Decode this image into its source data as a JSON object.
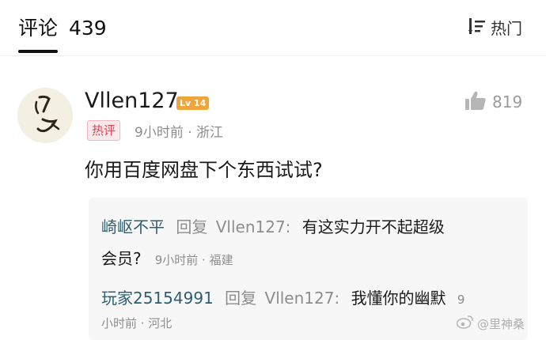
{
  "header": {
    "comments_label": "评论",
    "comments_count": "439",
    "sort_label": "热门"
  },
  "comment": {
    "username": "Vllen127",
    "level": "Lv 14",
    "likes": "819",
    "hot_badge": "热评",
    "meta": "9小时前 · 浙江",
    "text": "你用百度网盘下个东西试试?"
  },
  "replies": [
    {
      "user": "崎岖不平",
      "action": "回复",
      "target": "Vllen127:",
      "text_line1": "有这实力开不起超级",
      "text_line2": "会员?",
      "meta": "9小时前 · 福建"
    },
    {
      "user": "玩家25154991",
      "action": "回复",
      "target": "Vllen127:",
      "text": "我懂你的幽默",
      "meta_line1": "9",
      "meta_line2": "小时前 · 河北"
    }
  ],
  "watermark": "@里神桑",
  "colors": {
    "reply_user": "#2c5f72",
    "level_badge": "#f0a53a",
    "hot_badge": "#e04556",
    "muted": "#8d8d8d"
  }
}
